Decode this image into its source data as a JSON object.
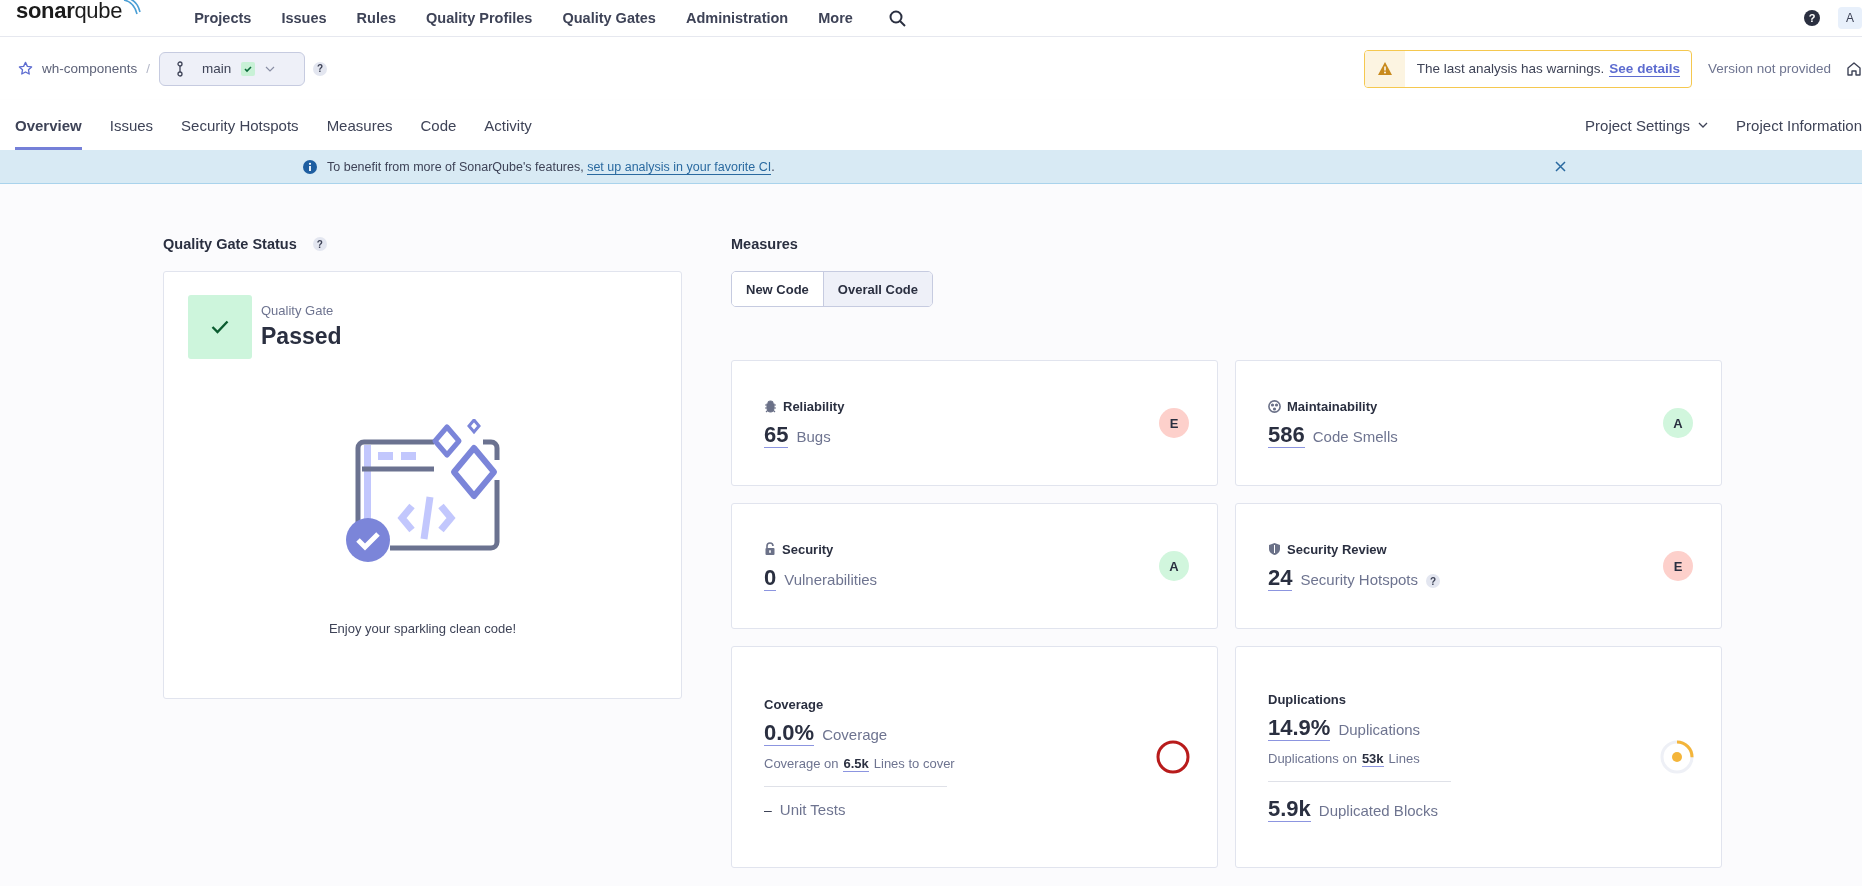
{
  "top_nav": {
    "logo": "**sonar**qube",
    "items": [
      "Projects",
      "Issues",
      "Rules",
      "Quality Profiles",
      "Quality Gates",
      "Administration",
      "More"
    ],
    "help": "?",
    "avatar": "A"
  },
  "project_bar": {
    "project": "wh-components",
    "separator": "/",
    "branch": "main",
    "help": "?",
    "warning": {
      "text": "The last analysis has warnings.",
      "link": "See details"
    },
    "version": "Version not provided"
  },
  "tabs": [
    {
      "label": "Overview",
      "selected": true
    },
    {
      "label": "Issues",
      "selected": false
    },
    {
      "label": "Security Hotspots",
      "selected": false
    },
    {
      "label": "Measures",
      "selected": false
    },
    {
      "label": "Code",
      "selected": false
    },
    {
      "label": "Activity",
      "selected": false
    }
  ],
  "right_tabs": [
    {
      "label": "Project Settings",
      "has_menu": true
    },
    {
      "label": "Project Information",
      "has_menu": false
    }
  ],
  "banner": {
    "text": "To benefit from more of SonarQube's features, ",
    "link": "set up analysis in your favorite CI",
    "end": "."
  },
  "quality_gate": {
    "title": "Quality Gate Status",
    "help": "?",
    "label": "Quality Gate",
    "status": "Passed",
    "passed": true,
    "message": "Enjoy your sparkling clean code!"
  },
  "measures": {
    "title": "Measures",
    "toggle": [
      {
        "label": "New Code",
        "selected": false
      },
      {
        "label": "Overall Code",
        "selected": true
      }
    ],
    "cards": [
      {
        "kind": "rating",
        "title": "Reliability",
        "value": "65",
        "unit": "Bugs",
        "rating": "E",
        "color": "#fdd0cb"
      },
      {
        "kind": "rating",
        "title": "Maintainability",
        "value": "586",
        "unit": "Code Smells",
        "rating": "A",
        "color": "#d1f6dd"
      },
      {
        "kind": "rating",
        "title": "Security",
        "value": "0",
        "unit": "Vulnerabilities",
        "rating": "A",
        "color": "#d1f6dd"
      },
      {
        "kind": "rating",
        "title": "Security Review",
        "value": "24",
        "unit": "Security Hotspots",
        "help": "?",
        "rating": "E",
        "color": "#fdd0cb"
      },
      {
        "kind": "coverage",
        "title": "Coverage",
        "value": "0.0%",
        "unit": "Coverage",
        "sub": {
          "prefix": "Coverage on",
          "value": "6.5k",
          "suffix": "Lines to cover"
        },
        "extra": {
          "value": "–",
          "unit": "Unit Tests"
        }
      },
      {
        "kind": "duplication",
        "title": "Duplications",
        "value": "14.9%",
        "unit": "Duplications",
        "sub": {
          "prefix": "Duplications on",
          "value": "53k",
          "suffix": "Lines"
        },
        "extra": {
          "value": "5.9k",
          "unit": "Duplicated Blocks"
        }
      }
    ]
  }
}
